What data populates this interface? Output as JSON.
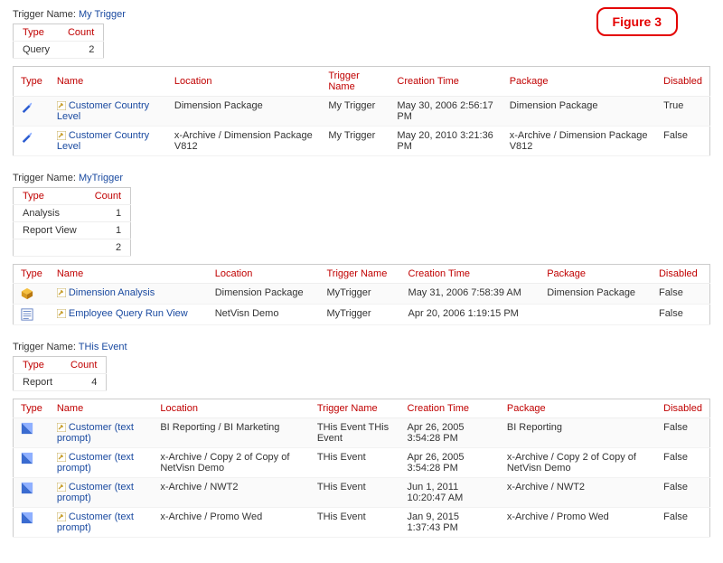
{
  "figure_label": "Figure 3",
  "headers": {
    "type": "Type",
    "count": "Count",
    "name": "Name",
    "location": "Location",
    "trigger_name": "Trigger Name",
    "creation_time": "Creation Time",
    "package": "Package",
    "disabled": "Disabled"
  },
  "trigger_label": "Trigger Name:",
  "sections": [
    {
      "trigger_name": "My Trigger",
      "summary": [
        {
          "type": "Query",
          "count": "2"
        }
      ],
      "summary_total": "",
      "rows": [
        {
          "icon": "query",
          "name": "Customer Country Level",
          "location": "Dimension Package",
          "trigger": "My Trigger",
          "created": "May 30, 2006 2:56:17 PM",
          "package": "Dimension Package",
          "disabled": "True"
        },
        {
          "icon": "query",
          "name": "Customer Country Level",
          "location": "x-Archive / Dimension Package V812",
          "trigger": "My Trigger",
          "created": "May 20, 2010 3:21:36 PM",
          "package": "x-Archive / Dimension Package V812",
          "disabled": "False"
        }
      ]
    },
    {
      "trigger_name": "MyTrigger",
      "summary": [
        {
          "type": "Analysis",
          "count": "1"
        },
        {
          "type": "Report View",
          "count": "1"
        }
      ],
      "summary_total": "2",
      "rows": [
        {
          "icon": "cube",
          "name": "Dimension Analysis",
          "location": "Dimension Package",
          "trigger": "MyTrigger",
          "created": "May 31, 2006 7:58:39 AM",
          "package": "Dimension Package",
          "disabled": "False"
        },
        {
          "icon": "view",
          "name": "Employee Query Run View",
          "location": "NetVisn Demo",
          "trigger": "MyTrigger",
          "created": "Apr 20, 2006 1:19:15 PM",
          "package": "",
          "disabled": "False"
        }
      ]
    },
    {
      "trigger_name": "THis Event",
      "summary": [
        {
          "type": "Report",
          "count": "4"
        }
      ],
      "summary_total": "",
      "rows": [
        {
          "icon": "report",
          "name": "Customer (text prompt)",
          "location": "BI Reporting / BI Marketing",
          "trigger": "THis Event THis Event",
          "created": "Apr 26, 2005 3:54:28 PM",
          "package": "BI Reporting",
          "disabled": "False"
        },
        {
          "icon": "report",
          "name": "Customer (text prompt)",
          "location": "x-Archive / Copy 2 of Copy of NetVisn Demo",
          "trigger": "THis Event",
          "created": "Apr 26, 2005 3:54:28 PM",
          "package": "x-Archive / Copy 2 of Copy of NetVisn Demo",
          "disabled": "False"
        },
        {
          "icon": "report",
          "name": "Customer (text prompt)",
          "location": "x-Archive / NWT2",
          "trigger": "THis Event",
          "created": "Jun 1, 2011 10:20:47 AM",
          "package": "x-Archive / NWT2",
          "disabled": "False"
        },
        {
          "icon": "report",
          "name": "Customer (text prompt)",
          "location": "x-Archive / Promo Wed",
          "trigger": "THis Event",
          "created": "Jan 9, 2015 1:37:43 PM",
          "package": "x-Archive / Promo Wed",
          "disabled": "False"
        }
      ]
    }
  ]
}
